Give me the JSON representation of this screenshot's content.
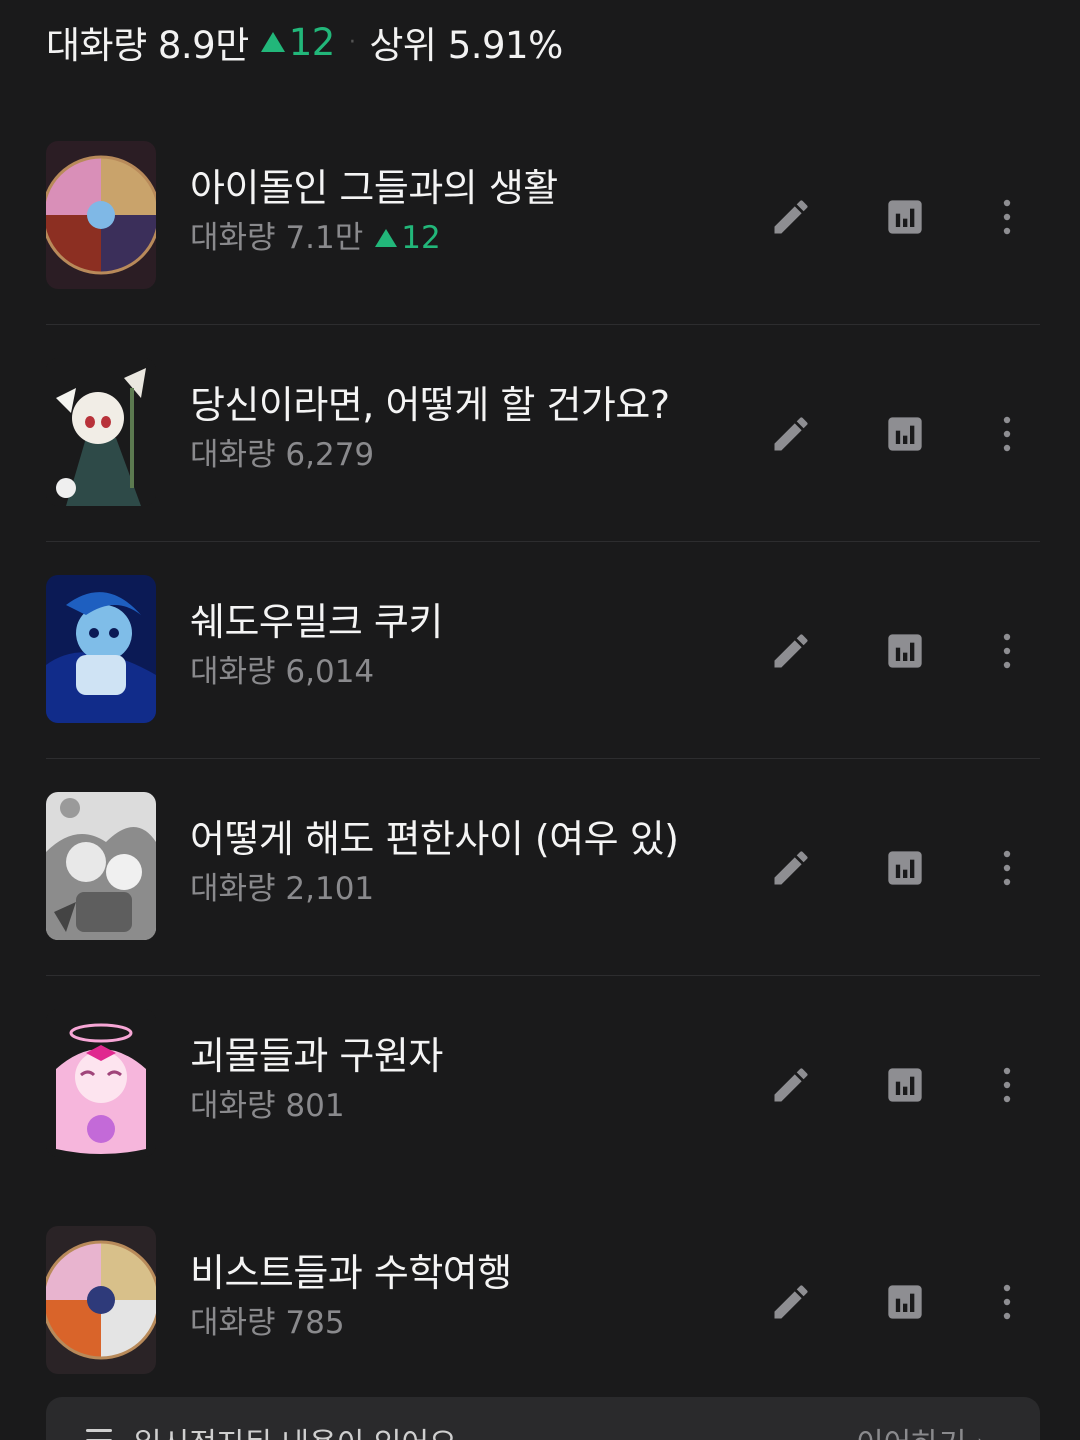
{
  "header": {
    "label": "대화량 8.9만",
    "delta": "12",
    "separator": "·",
    "rank": "상위 5.91%"
  },
  "colors": {
    "background": "#1a1a1b",
    "accent_up": "#22b77a",
    "subtext": "#8a8a8d"
  },
  "items": [
    {
      "title": "아이돌인 그들과의 생활",
      "stats": "대화량 7.1만",
      "delta": "12"
    },
    {
      "title": "당신이라면, 어떻게 할 건가요?",
      "stats": "대화량 6,279",
      "delta": null
    },
    {
      "title": "쉐도우밀크 쿠키",
      "stats": "대화량 6,014",
      "delta": null
    },
    {
      "title": "어떻게 해도 편한사이 (여우 있)",
      "stats": "대화량 2,101",
      "delta": null
    },
    {
      "title": "괴물들과 구원자",
      "stats": "대화량 801",
      "delta": null
    },
    {
      "title": "비스트들과 수학여행",
      "stats": "대화량 785",
      "delta": null
    }
  ],
  "icons": {
    "edit": "pencil-icon",
    "stats": "bar-chart-icon",
    "more": "more-vertical-icon"
  },
  "banner": {
    "text": "일시정지된 내용이 있어요",
    "link": "이어하기 ›"
  }
}
